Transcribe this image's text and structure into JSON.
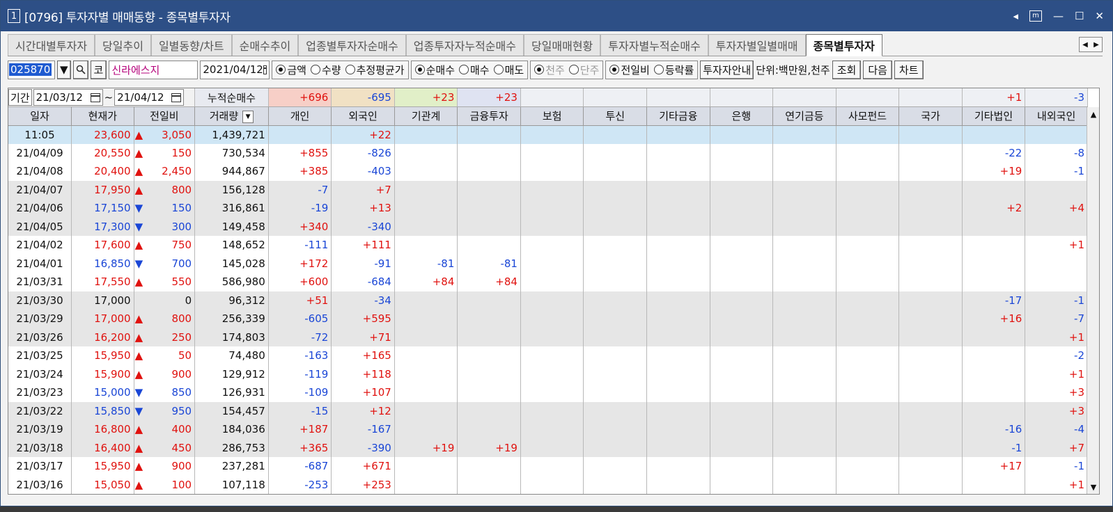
{
  "window": {
    "number": "1",
    "title": "[0796] 투자자별 매매동향 - 종목별투자자"
  },
  "tabs": [
    "시간대별투자자",
    "당일추이",
    "일별동향/차트",
    "순매수추이",
    "업종별투자자순매수",
    "업종투자자누적순매수",
    "당일매매현황",
    "투자자별누적순매수",
    "투자자별일별매매",
    "종목별투자자"
  ],
  "toolbar": {
    "code": "025870",
    "market": "코",
    "name": "신라에스지",
    "date": "2021/04/12",
    "radio1": [
      {
        "label": "금액",
        "on": true
      },
      {
        "label": "수량",
        "on": false
      },
      {
        "label": "추정평균가",
        "on": false
      }
    ],
    "radio2": [
      {
        "label": "순매수",
        "on": true
      },
      {
        "label": "매수",
        "on": false
      },
      {
        "label": "매도",
        "on": false
      }
    ],
    "radio3": [
      {
        "label": "천주",
        "on": true
      },
      {
        "label": "단주",
        "on": false
      }
    ],
    "radio4": [
      {
        "label": "전일비",
        "on": true
      },
      {
        "label": "등락률",
        "on": false
      }
    ],
    "guide": "투자자안내",
    "unit": "단위:백만원,천주",
    "query": "조회",
    "next": "다음",
    "chart": "차트"
  },
  "period": {
    "label": "기간",
    "from": "21/03/12",
    "tilde": "~",
    "to": "21/04/12",
    "sum_label": "누적순매수"
  },
  "summary": [
    "+696",
    "-695",
    "+23",
    "+23",
    "",
    "",
    "",
    "",
    "",
    "",
    "",
    "+1",
    "-3"
  ],
  "columns": [
    "일자",
    "현재가",
    "전일비",
    "거래량",
    "개인",
    "외국인",
    "기관계",
    "금융투자",
    "보험",
    "투신",
    "기타금융",
    "은행",
    "연기금등",
    "사모펀드",
    "국가",
    "기타법인",
    "내외국인"
  ],
  "rows": [
    {
      "d": "11:05",
      "p": "23,600",
      "pc": "red",
      "a": "▲",
      "ac": "red",
      "ch": "3,050",
      "v": "1,439,721",
      "vals": [
        "",
        "+22",
        "",
        "",
        "",
        "",
        "",
        "",
        "",
        "",
        "",
        "",
        ""
      ],
      "bg": "sel"
    },
    {
      "d": "21/04/09",
      "p": "20,550",
      "pc": "red",
      "a": "▲",
      "ac": "red",
      "ch": "150",
      "v": "730,534",
      "vals": [
        "+855",
        "-826",
        "",
        "",
        "",
        "",
        "",
        "",
        "",
        "",
        "",
        "-22",
        "-8"
      ],
      "bg": "w"
    },
    {
      "d": "21/04/08",
      "p": "20,400",
      "pc": "red",
      "a": "▲",
      "ac": "red",
      "ch": "2,450",
      "v": "944,867",
      "vals": [
        "+385",
        "-403",
        "",
        "",
        "",
        "",
        "",
        "",
        "",
        "",
        "",
        "+19",
        "-1"
      ],
      "bg": "w"
    },
    {
      "d": "21/04/07",
      "p": "17,950",
      "pc": "red",
      "a": "▲",
      "ac": "red",
      "ch": "800",
      "v": "156,128",
      "vals": [
        "-7",
        "+7",
        "",
        "",
        "",
        "",
        "",
        "",
        "",
        "",
        "",
        "",
        ""
      ],
      "bg": "g"
    },
    {
      "d": "21/04/06",
      "p": "17,150",
      "pc": "blue",
      "a": "▼",
      "ac": "blue",
      "ch": "150",
      "v": "316,861",
      "vals": [
        "-19",
        "+13",
        "",
        "",
        "",
        "",
        "",
        "",
        "",
        "",
        "",
        "+2",
        "+4"
      ],
      "bg": "g"
    },
    {
      "d": "21/04/05",
      "p": "17,300",
      "pc": "blue",
      "a": "▼",
      "ac": "blue",
      "ch": "300",
      "v": "149,458",
      "vals": [
        "+340",
        "-340",
        "",
        "",
        "",
        "",
        "",
        "",
        "",
        "",
        "",
        "",
        ""
      ],
      "bg": "g"
    },
    {
      "d": "21/04/02",
      "p": "17,600",
      "pc": "red",
      "a": "▲",
      "ac": "red",
      "ch": "750",
      "v": "148,652",
      "vals": [
        "-111",
        "+111",
        "",
        "",
        "",
        "",
        "",
        "",
        "",
        "",
        "",
        "",
        "+1"
      ],
      "bg": "w"
    },
    {
      "d": "21/04/01",
      "p": "16,850",
      "pc": "blue",
      "a": "▼",
      "ac": "blue",
      "ch": "700",
      "v": "145,028",
      "vals": [
        "+172",
        "-91",
        "-81",
        "-81",
        "",
        "",
        "",
        "",
        "",
        "",
        "",
        "",
        ""
      ],
      "bg": "w"
    },
    {
      "d": "21/03/31",
      "p": "17,550",
      "pc": "red",
      "a": "▲",
      "ac": "red",
      "ch": "550",
      "v": "586,980",
      "vals": [
        "+600",
        "-684",
        "+84",
        "+84",
        "",
        "",
        "",
        "",
        "",
        "",
        "",
        "",
        ""
      ],
      "bg": "w"
    },
    {
      "d": "21/03/30",
      "p": "17,000",
      "pc": "blk",
      "a": "",
      "ac": "blk",
      "ch": "0",
      "v": "96,312",
      "vals": [
        "+51",
        "-34",
        "",
        "",
        "",
        "",
        "",
        "",
        "",
        "",
        "",
        "-17",
        "-1"
      ],
      "bg": "g"
    },
    {
      "d": "21/03/29",
      "p": "17,000",
      "pc": "red",
      "a": "▲",
      "ac": "red",
      "ch": "800",
      "v": "256,339",
      "vals": [
        "-605",
        "+595",
        "",
        "",
        "",
        "",
        "",
        "",
        "",
        "",
        "",
        "+16",
        "-7"
      ],
      "bg": "g"
    },
    {
      "d": "21/03/26",
      "p": "16,200",
      "pc": "red",
      "a": "▲",
      "ac": "red",
      "ch": "250",
      "v": "174,803",
      "vals": [
        "-72",
        "+71",
        "",
        "",
        "",
        "",
        "",
        "",
        "",
        "",
        "",
        "",
        "+1"
      ],
      "bg": "g"
    },
    {
      "d": "21/03/25",
      "p": "15,950",
      "pc": "red",
      "a": "▲",
      "ac": "red",
      "ch": "50",
      "v": "74,480",
      "vals": [
        "-163",
        "+165",
        "",
        "",
        "",
        "",
        "",
        "",
        "",
        "",
        "",
        "",
        "-2"
      ],
      "bg": "w"
    },
    {
      "d": "21/03/24",
      "p": "15,900",
      "pc": "red",
      "a": "▲",
      "ac": "red",
      "ch": "900",
      "v": "129,912",
      "vals": [
        "-119",
        "+118",
        "",
        "",
        "",
        "",
        "",
        "",
        "",
        "",
        "",
        "",
        "+1"
      ],
      "bg": "w"
    },
    {
      "d": "21/03/23",
      "p": "15,000",
      "pc": "blue",
      "a": "▼",
      "ac": "blue",
      "ch": "850",
      "v": "126,931",
      "vals": [
        "-109",
        "+107",
        "",
        "",
        "",
        "",
        "",
        "",
        "",
        "",
        "",
        "",
        "+3"
      ],
      "bg": "w"
    },
    {
      "d": "21/03/22",
      "p": "15,850",
      "pc": "blue",
      "a": "▼",
      "ac": "blue",
      "ch": "950",
      "v": "154,457",
      "vals": [
        "-15",
        "+12",
        "",
        "",
        "",
        "",
        "",
        "",
        "",
        "",
        "",
        "",
        "+3"
      ],
      "bg": "g"
    },
    {
      "d": "21/03/19",
      "p": "16,800",
      "pc": "red",
      "a": "▲",
      "ac": "red",
      "ch": "400",
      "v": "184,036",
      "vals": [
        "+187",
        "-167",
        "",
        "",
        "",
        "",
        "",
        "",
        "",
        "",
        "",
        "-16",
        "-4"
      ],
      "bg": "g"
    },
    {
      "d": "21/03/18",
      "p": "16,400",
      "pc": "red",
      "a": "▲",
      "ac": "red",
      "ch": "450",
      "v": "286,753",
      "vals": [
        "+365",
        "-390",
        "+19",
        "+19",
        "",
        "",
        "",
        "",
        "",
        "",
        "",
        "-1",
        "+7"
      ],
      "bg": "g"
    },
    {
      "d": "21/03/17",
      "p": "15,950",
      "pc": "red",
      "a": "▲",
      "ac": "red",
      "ch": "900",
      "v": "237,281",
      "vals": [
        "-687",
        "+671",
        "",
        "",
        "",
        "",
        "",
        "",
        "",
        "",
        "",
        "+17",
        "-1"
      ],
      "bg": "w"
    },
    {
      "d": "21/03/16",
      "p": "15,050",
      "pc": "red",
      "a": "▲",
      "ac": "red",
      "ch": "100",
      "v": "107,118",
      "vals": [
        "-253",
        "+253",
        "",
        "",
        "",
        "",
        "",
        "",
        "",
        "",
        "",
        "",
        "+1"
      ],
      "bg": "w"
    }
  ],
  "colors": {
    "up": "#e0120f",
    "down": "#1a46d6",
    "title_bar": "#2d4f86",
    "selected_row": "#cfe6f5"
  }
}
